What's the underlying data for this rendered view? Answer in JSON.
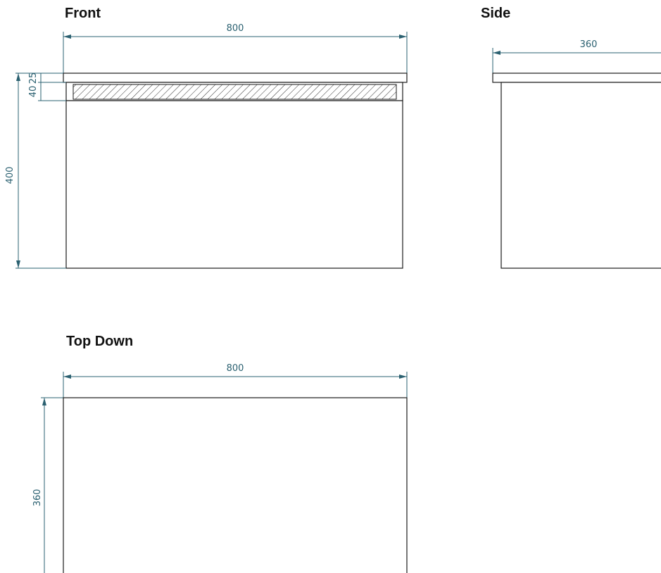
{
  "views": {
    "front": {
      "title": "Front",
      "width_label": "800",
      "height_label": "400",
      "top_label": "25",
      "drawer_label": "40"
    },
    "side": {
      "title": "Side",
      "depth_label": "360"
    },
    "top": {
      "title": "Top Down",
      "width_label": "800",
      "depth_label": "360"
    }
  },
  "colors": {
    "dimension": "#2a6070",
    "outline": "#1a1a1a"
  }
}
